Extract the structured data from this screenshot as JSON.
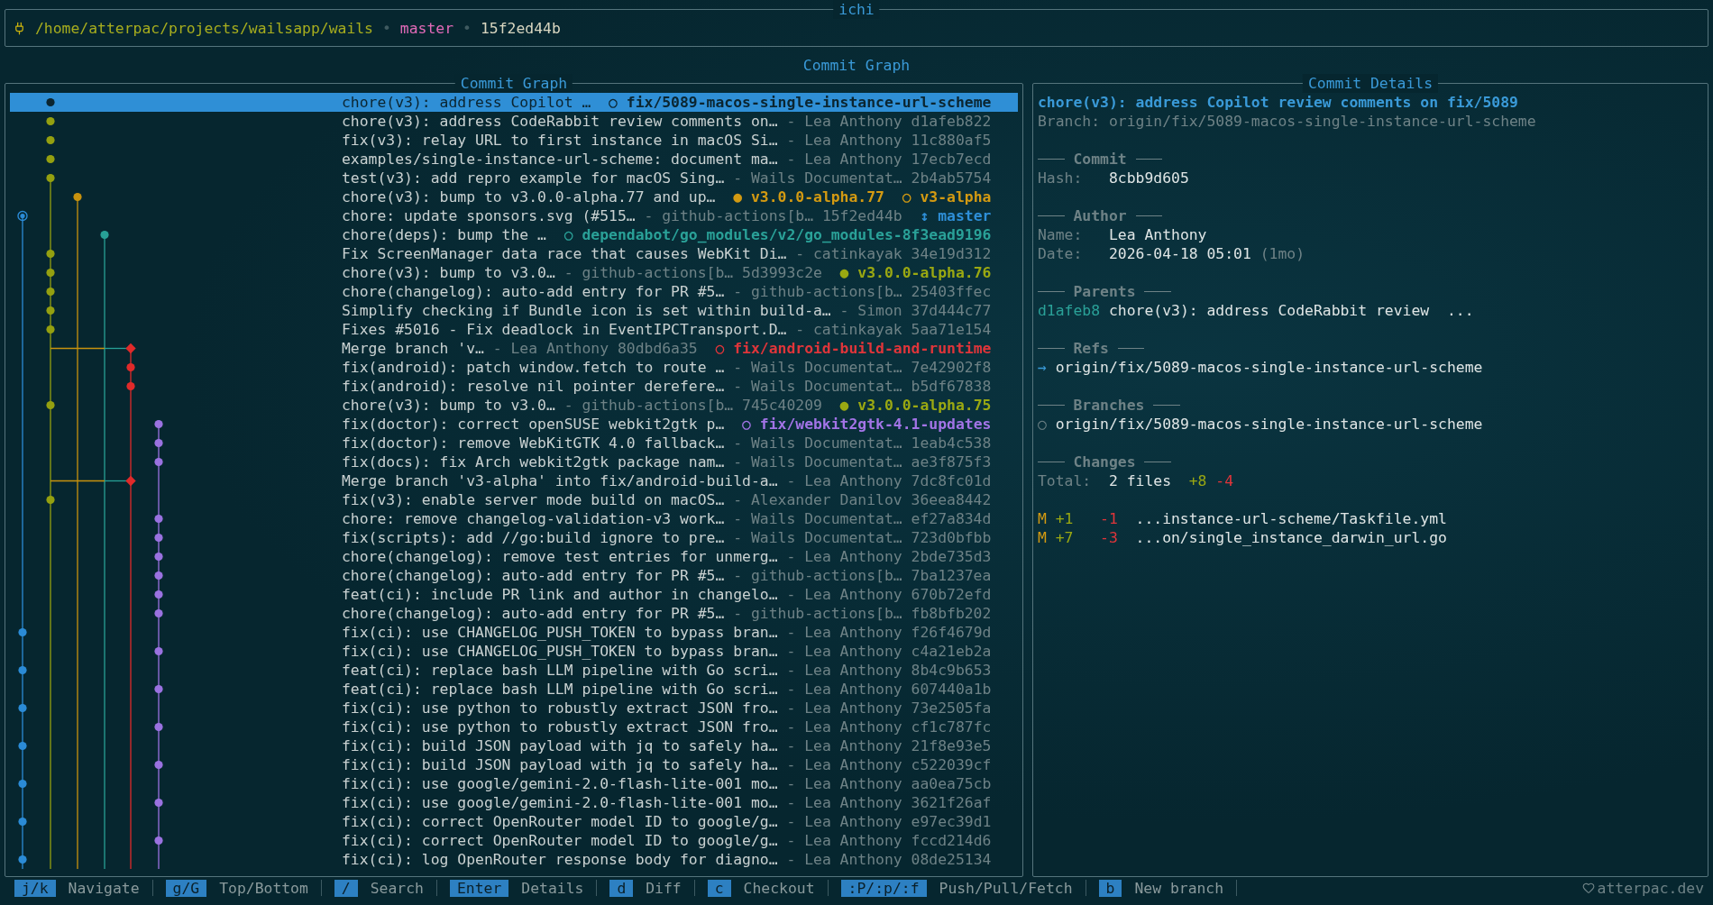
{
  "app_title": "ichi",
  "header": {
    "path": "/home/atterpac/projects/wailsapp/wails",
    "separator": "•",
    "branch": "master",
    "hash": "15f2ed44b"
  },
  "view_title": "Commit Graph",
  "graph_panel": {
    "title": "Commit Graph",
    "rows": [
      {
        "subject": "chore(v3): address Copilot …",
        "refs": [
          {
            "icon": "○",
            "name": "fix/5089-macos-single-instance-url-scheme"
          }
        ],
        "selected": true
      },
      {
        "subject": "chore(v3): address CodeRabbit review comments on…",
        "author": "- Lea Anthony",
        "hash": "d1afeb822",
        "selected": false
      },
      {
        "subject": "fix(v3): relay URL to first instance in macOS Si…",
        "author": "- Lea Anthony",
        "hash": "11c880af5",
        "selected": false
      },
      {
        "subject": "examples/single-instance-url-scheme: document ma…",
        "author": "- Lea Anthony",
        "hash": "17ecb7ecd",
        "selected": false
      },
      {
        "subject": "test(v3): add repro example for macOS Sing…",
        "author": "- Wails Documentat…",
        "hash": "2b4ab5754",
        "selected": false
      },
      {
        "subject": "chore(v3): bump to v3.0.0-alpha.77 and up…",
        "refs": [
          {
            "icon": "●",
            "name": "v3.0.0-alpha.77",
            "color": "#d39a12"
          },
          {
            "icon": "○",
            "name": "v3-alpha",
            "color": "#d39a12"
          }
        ],
        "selected": false
      },
      {
        "subject": "chore: update sponsors.svg (#515…",
        "author": "- github-actions[b…",
        "hash": "15f2ed44b",
        "refs": [
          {
            "icon": "↕",
            "name": "master",
            "color": "#2e8fd8"
          }
        ],
        "selected": false
      },
      {
        "subject": "chore(deps): bump the …",
        "refs": [
          {
            "icon": "○",
            "name": "dependabot/go_modules/v2/go_modules-8f3ead9196",
            "color": "#2aa198"
          }
        ],
        "selected": false
      },
      {
        "subject": "Fix ScreenManager data race that causes WebKit Di…",
        "author": "- catinkayak",
        "hash": "34e19d312",
        "selected": false
      },
      {
        "subject": "chore(v3): bump to v3.0…",
        "author": "- github-actions[b…",
        "hash": "5d3993c2e",
        "refs": [
          {
            "icon": "●",
            "name": "v3.0.0-alpha.76",
            "color": "#9aa812"
          }
        ],
        "selected": false
      },
      {
        "subject": "chore(changelog): auto-add entry for PR #5…",
        "author": "- github-actions[b…",
        "hash": "25403ffec",
        "selected": false
      },
      {
        "subject": "Simplify checking if Bundle icon is set within build-a…",
        "author": "- Simon",
        "hash": "37d444c77",
        "selected": false
      },
      {
        "subject": "Fixes #5016 - Fix deadlock in EventIPCTransport.D…",
        "author": "- catinkayak",
        "hash": "5aa71e154",
        "selected": false
      },
      {
        "subject": "Merge branch 'v…",
        "author": "- Lea Anthony",
        "hash": "80dbd6a35",
        "refs": [
          {
            "icon": "○",
            "name": "fix/android-build-and-runtime",
            "color": "#e0353a"
          }
        ],
        "selected": false
      },
      {
        "subject": "fix(android): patch window.fetch to route …",
        "author": "- Wails Documentat…",
        "hash": "7e42902f8",
        "selected": false
      },
      {
        "subject": "fix(android): resolve nil pointer derefere…",
        "author": "- Wails Documentat…",
        "hash": "b5df67838",
        "selected": false
      },
      {
        "subject": "chore(v3): bump to v3.0…",
        "author": "- github-actions[b…",
        "hash": "745c40209",
        "refs": [
          {
            "icon": "●",
            "name": "v3.0.0-alpha.75",
            "color": "#9aa812"
          }
        ],
        "selected": false
      },
      {
        "subject": "fix(doctor): correct openSUSE webkit2gtk p…",
        "refs": [
          {
            "icon": "○",
            "name": "fix/webkit2gtk-4.1-updates",
            "color": "#a274e6"
          }
        ],
        "selected": false
      },
      {
        "subject": "fix(doctor): remove WebKitGTK 4.0 fallback…",
        "author": "- Wails Documentat…",
        "hash": "1eab4c538",
        "selected": false
      },
      {
        "subject": "fix(docs): fix Arch webkit2gtk package nam…",
        "author": "- Wails Documentat…",
        "hash": "ae3f875f3",
        "selected": false
      },
      {
        "subject": "Merge branch 'v3-alpha' into fix/android-build-a…",
        "author": "- Lea Anthony",
        "hash": "7dc8fc01d",
        "selected": false
      },
      {
        "subject": "fix(v3): enable server mode build on macOS…",
        "author": "- Alexander Danilov",
        "hash": "36eea8442",
        "selected": false
      },
      {
        "subject": "chore: remove changelog-validation-v3 work…",
        "author": "- Wails Documentat…",
        "hash": "ef27a834d",
        "selected": false
      },
      {
        "subject": "fix(scripts): add //go:build ignore to pre…",
        "author": "- Wails Documentat…",
        "hash": "723d0bfbb",
        "selected": false
      },
      {
        "subject": "chore(changelog): remove test entries for unmerg…",
        "author": "- Lea Anthony",
        "hash": "2bde735d3",
        "selected": false
      },
      {
        "subject": "chore(changelog): auto-add entry for PR #5…",
        "author": "- github-actions[b…",
        "hash": "7ba1237ea",
        "selected": false
      },
      {
        "subject": "feat(ci): include PR link and author in changelo…",
        "author": "- Lea Anthony",
        "hash": "670b72efd",
        "selected": false
      },
      {
        "subject": "chore(changelog): auto-add entry for PR #5…",
        "author": "- github-actions[b…",
        "hash": "fb8bfb202",
        "selected": false
      },
      {
        "subject": "fix(ci): use CHANGELOG_PUSH_TOKEN to bypass bran…",
        "author": "- Lea Anthony",
        "hash": "f26f4679d",
        "selected": false
      },
      {
        "subject": "fix(ci): use CHANGELOG_PUSH_TOKEN to bypass bran…",
        "author": "- Lea Anthony",
        "hash": "c4a21eb2a",
        "selected": false
      },
      {
        "subject": "feat(ci): replace bash LLM pipeline with Go scri…",
        "author": "- Lea Anthony",
        "hash": "8b4c9b653",
        "selected": false
      },
      {
        "subject": "feat(ci): replace bash LLM pipeline with Go scri…",
        "author": "- Lea Anthony",
        "hash": "607440a1b",
        "selected": false
      },
      {
        "subject": "fix(ci): use python to robustly extract JSON fro…",
        "author": "- Lea Anthony",
        "hash": "73e2505fa",
        "selected": false
      },
      {
        "subject": "fix(ci): use python to robustly extract JSON fro…",
        "author": "- Lea Anthony",
        "hash": "cf1c787fc",
        "selected": false
      },
      {
        "subject": "fix(ci): build JSON payload with jq to safely ha…",
        "author": "- Lea Anthony",
        "hash": "21f8e93e5",
        "selected": false
      },
      {
        "subject": "fix(ci): build JSON payload with jq to safely ha…",
        "author": "- Lea Anthony",
        "hash": "c522039cf",
        "selected": false
      },
      {
        "subject": "fix(ci): use google/gemini-2.0-flash-lite-001 mo…",
        "author": "- Lea Anthony",
        "hash": "aa0ea75cb",
        "selected": false
      },
      {
        "subject": "fix(ci): use google/gemini-2.0-flash-lite-001 mo…",
        "author": "- Lea Anthony",
        "hash": "3621f26af",
        "selected": false
      },
      {
        "subject": "fix(ci): correct OpenRouter model ID to google/g…",
        "author": "- Lea Anthony",
        "hash": "e97ec39d1",
        "selected": false
      },
      {
        "subject": "fix(ci): correct OpenRouter model ID to google/g…",
        "author": "- Lea Anthony",
        "hash": "fccd214d6",
        "selected": false
      },
      {
        "subject": "fix(ci): log OpenRouter response body for diagno…",
        "author": "- Lea Anthony",
        "hash": "08de25134",
        "selected": false
      }
    ]
  },
  "details_panel": {
    "title": "Commit Details",
    "heading": "chore(v3): address Copilot review comments on fix/5089",
    "branch_line": "Branch: origin/fix/5089-macos-single-instance-url-scheme",
    "sections": [
      {
        "kind": "fields",
        "title": "Commit",
        "fields": [
          {
            "label": "Hash:",
            "value": "8cbb9d605"
          }
        ]
      },
      {
        "kind": "fields",
        "title": "Author",
        "fields": [
          {
            "label": "Name:",
            "value": "Lea Anthony"
          },
          {
            "label": "Date:",
            "value": "2026-04-18 05:01",
            "note": "(1mo)"
          }
        ]
      },
      {
        "kind": "parents",
        "title": "Parents",
        "items": [
          {
            "hash": "d1afeb8",
            "subject": "chore(v3): address CodeRabbit review  ..."
          }
        ]
      },
      {
        "kind": "refs",
        "title": "Refs",
        "items": [
          {
            "icon": "→",
            "name": "origin/fix/5089-macos-single-instance-url-scheme"
          }
        ]
      },
      {
        "kind": "branches",
        "title": "Branches",
        "items": [
          {
            "icon": "○",
            "name": "origin/fix/5089-macos-single-instance-url-scheme"
          }
        ]
      },
      {
        "kind": "changes",
        "title": "Changes",
        "total": {
          "label": "Total:",
          "files": "2 files",
          "added": "+8",
          "removed": "-4"
        },
        "files": [
          {
            "status": "M",
            "added": "+1",
            "removed": "-1",
            "path": "...instance-url-scheme/Taskfile.yml"
          },
          {
            "status": "M",
            "added": "+7",
            "removed": "-3",
            "path": "...on/single_instance_darwin_url.go"
          }
        ]
      }
    ]
  },
  "keybinds": [
    {
      "key": "j/k",
      "label": "Navigate"
    },
    {
      "key": "g/G",
      "label": "Top/Bottom"
    },
    {
      "key": "/",
      "label": "Search"
    },
    {
      "key": "Enter",
      "label": "Details"
    },
    {
      "key": "d",
      "label": "Diff"
    },
    {
      "key": "c",
      "label": "Checkout"
    },
    {
      "key": ":P/:p/:f",
      "label": "Push/Pull/Fetch"
    },
    {
      "key": "b",
      "label": "New branch"
    }
  ],
  "credit": "atterpac.dev"
}
